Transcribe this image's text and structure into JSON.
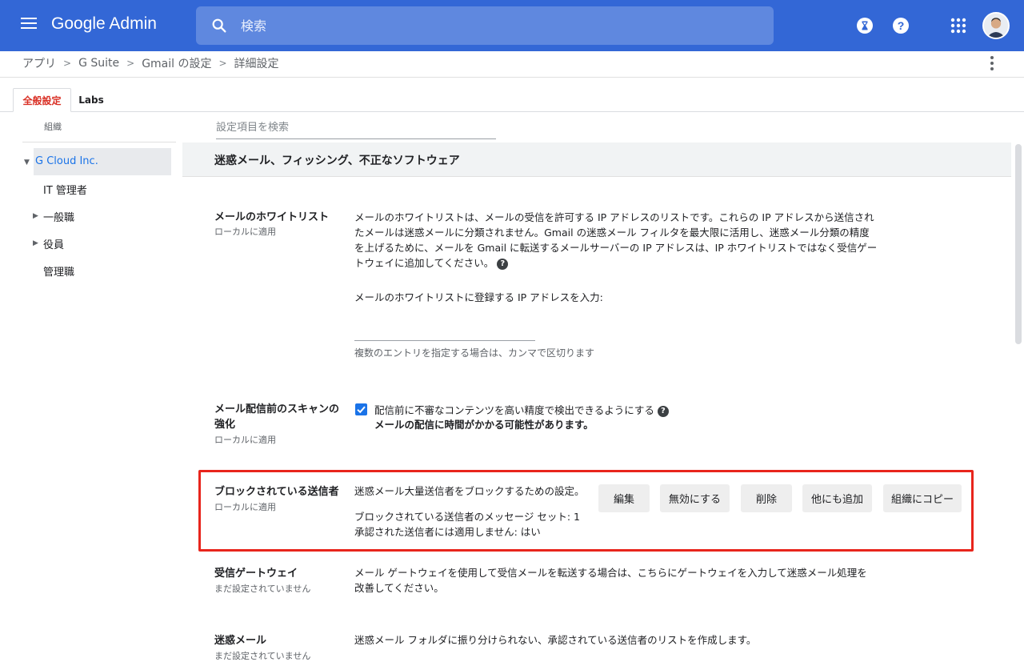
{
  "app": {
    "brand": "Google Admin"
  },
  "search": {
    "placeholder": "検索"
  },
  "breadcrumb": [
    "アプリ",
    "G Suite",
    "Gmail の設定",
    "詳細設定"
  ],
  "tabs": [
    {
      "label": "全般設定",
      "active": true
    },
    {
      "label": "Labs",
      "active": false
    }
  ],
  "sidebar": {
    "heading": "組織",
    "root": "G Cloud Inc.",
    "children": [
      "IT 管理者",
      "一般職",
      "役員",
      "管理職"
    ]
  },
  "main": {
    "settings_search_placeholder": "設定項目を検索",
    "section_title": "迷惑メール、フィッシング、不正なソフトウェア",
    "whitelist": {
      "title": "メールのホワイトリスト",
      "sub": "ローカルに適用",
      "desc": [
        "メールのホワイトリストは、メールの受信を許可する IP アドレスのリストです。これらの IP アドレスから送信され",
        "たメールは迷惑メールに分類されません。Gmail の迷惑メール フィルタを最大限に活用し、迷惑メール分類の精度",
        "を上げるために、メールを Gmail に転送するメールサーバーの IP アドレスは、IP ホワイトリストではなく受信ゲー",
        "トウェイに追加してください。"
      ],
      "input_label": "メールのホワイトリストに登録する IP アドレスを入力:",
      "input_value": "",
      "hint": "複数のエントリを指定する場合は、カンマで区切ります"
    },
    "prescan": {
      "title": "メール配信前のスキャンの強化",
      "sub": "ローカルに適用",
      "checkbox_label": "配信前に不審なコンテンツを高い精度で検出できるようにする",
      "checked": true,
      "warning": "メールの配信に時間がかかる可能性があります。"
    },
    "blocked": {
      "title": "ブロックされている送信者",
      "sub": "ローカルに適用",
      "desc": "迷惑メール大量送信者をブロックするための設定。",
      "msg_set": "ブロックされている送信者のメッセージ セット: 1",
      "not_applied": "承認された送信者には適用しません: はい",
      "buttons": [
        "編集",
        "無効にする",
        "削除",
        "他にも追加",
        "組織にコピー"
      ]
    },
    "gateway": {
      "title": "受信ゲートウェイ",
      "sub": "まだ設定されていません",
      "desc": [
        "メール ゲートウェイを使用して受信メールを転送する場合は、こちらにゲートウェイを入力して迷惑メール処理を",
        "改善してください。"
      ]
    },
    "spam": {
      "title": "迷惑メール",
      "sub": "まだ設定されていません",
      "desc": "迷惑メール フォルダに振り分けられない、承認されている送信者のリストを作成します。"
    }
  },
  "colors": {
    "topbar": "#3367d6",
    "highlight": "#e8251c",
    "active_tab": "#d93025",
    "link": "#1a73e8"
  }
}
